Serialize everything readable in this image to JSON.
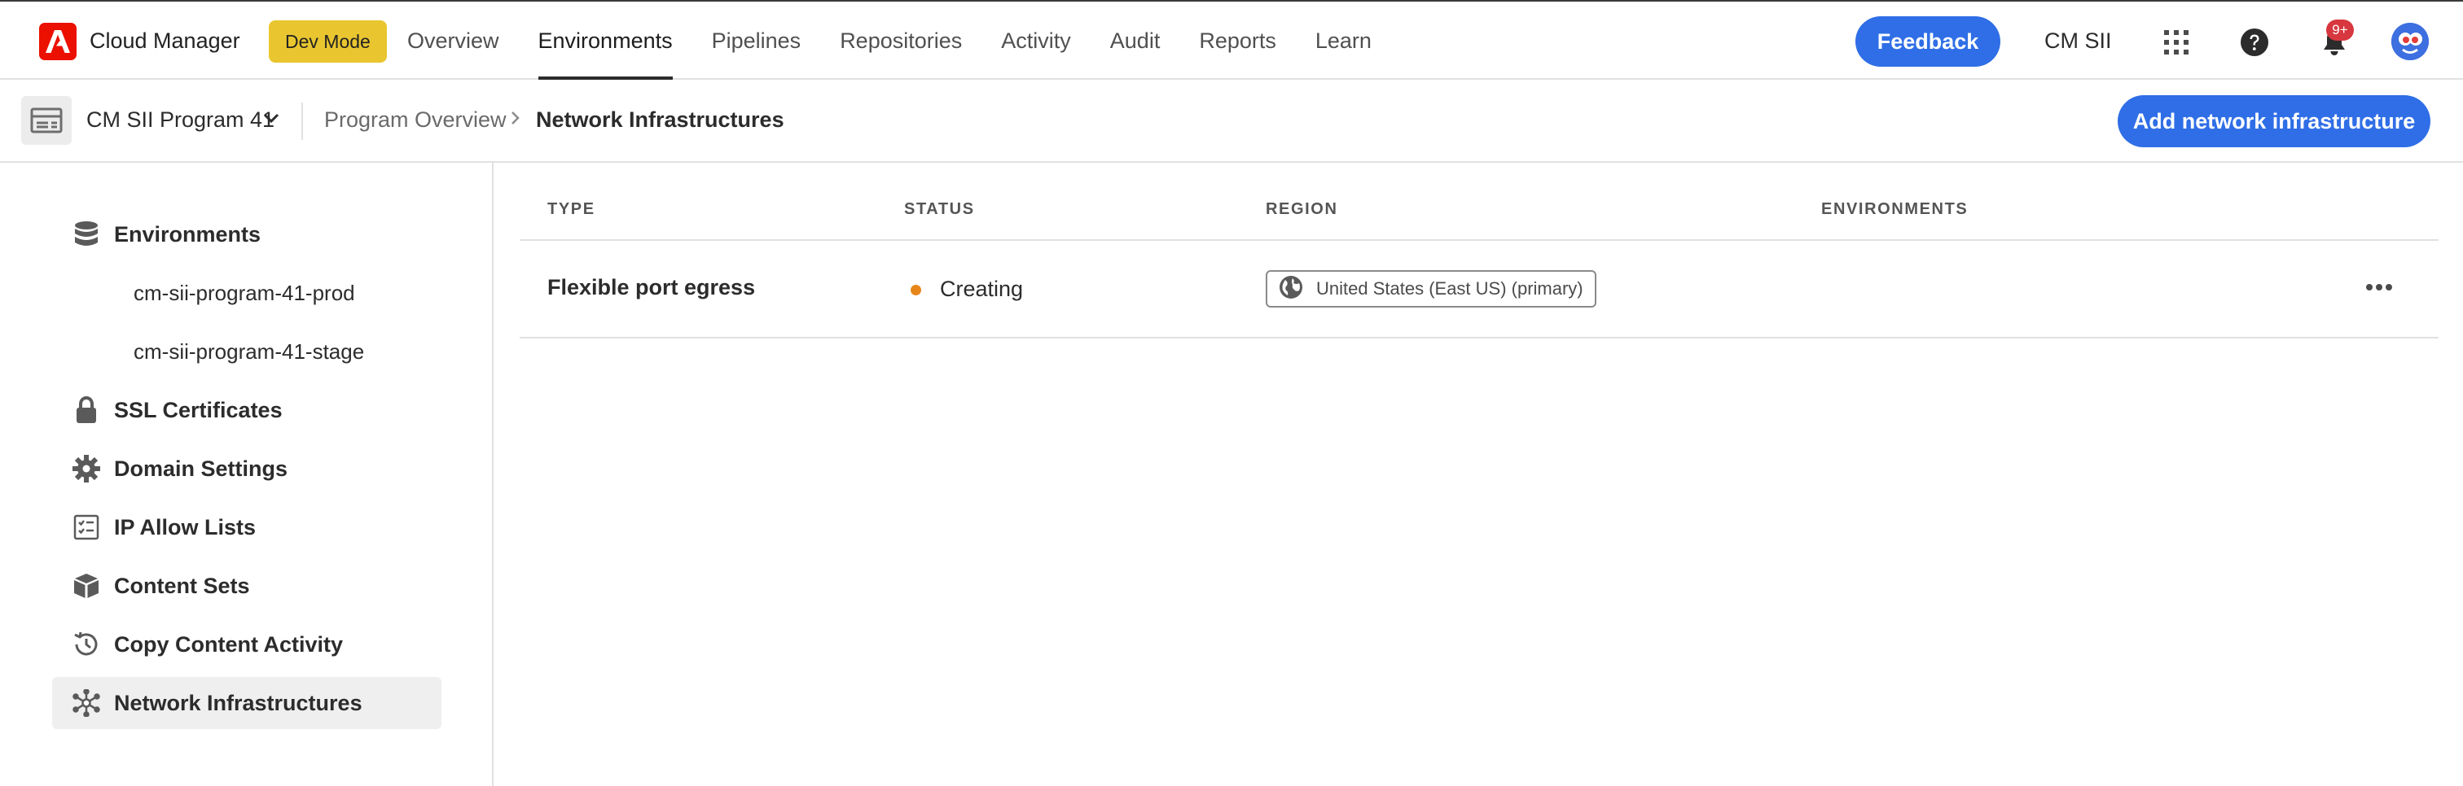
{
  "app": {
    "title": "Cloud Manager",
    "dev_mode_label": "Dev Mode"
  },
  "nav": {
    "items": [
      {
        "label": "Overview",
        "active": false
      },
      {
        "label": "Environments",
        "active": true
      },
      {
        "label": "Pipelines",
        "active": false
      },
      {
        "label": "Repositories",
        "active": false
      },
      {
        "label": "Activity",
        "active": false
      },
      {
        "label": "Audit",
        "active": false
      },
      {
        "label": "Reports",
        "active": false
      },
      {
        "label": "Learn",
        "active": false
      }
    ],
    "feedback_label": "Feedback",
    "org_name": "CM SII",
    "notification_badge": "9+",
    "icons": [
      "apps-grid-icon",
      "help-icon",
      "bell-icon",
      "avatar"
    ]
  },
  "subheader": {
    "program_name": "CM SII Program 41",
    "breadcrumb": [
      "Program Overview",
      "Network Infrastructures"
    ],
    "add_button_label": "Add network infrastructure"
  },
  "sidebar": {
    "environments_label": "Environments",
    "environments": [
      "cm-sii-program-41-prod",
      "cm-sii-program-41-stage"
    ],
    "items": [
      {
        "label": "SSL Certificates",
        "icon": "lock-icon"
      },
      {
        "label": "Domain Settings",
        "icon": "gear-icon"
      },
      {
        "label": "IP Allow Lists",
        "icon": "checklist-icon"
      },
      {
        "label": "Content Sets",
        "icon": "boxes-icon"
      },
      {
        "label": "Copy Content Activity",
        "icon": "history-icon"
      },
      {
        "label": "Network Infrastructures",
        "icon": "network-icon",
        "selected": true
      }
    ]
  },
  "table": {
    "columns": [
      "TYPE",
      "STATUS",
      "REGION",
      "ENVIRONMENTS"
    ],
    "rows": [
      {
        "type": "Flexible port egress",
        "status": "Creating",
        "region": "United States (East US) (primary)",
        "environments": ""
      }
    ]
  },
  "colors": {
    "accent": "#2f6ee6",
    "dev_mode": "#e9c62f",
    "status_creating": "#e68619",
    "brand": "#eb1000",
    "badge": "#d7373f"
  }
}
